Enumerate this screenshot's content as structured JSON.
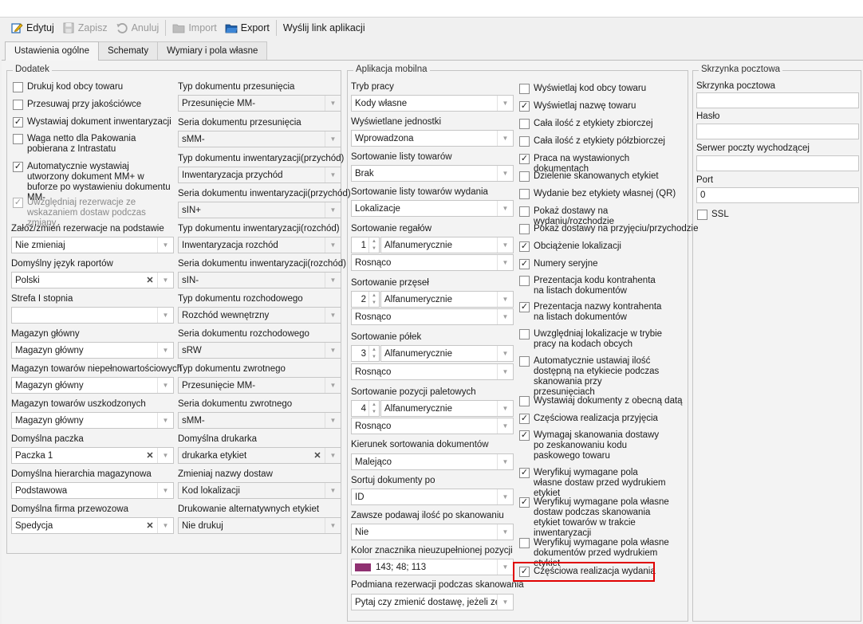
{
  "toolbar": {
    "edit": "Edytuj",
    "save": "Zapisz",
    "cancel": "Anuluj",
    "import": "Import",
    "export": "Export",
    "send_link": "Wyślij link aplikacji"
  },
  "tabs": [
    "Ustawienia ogólne",
    "Schematy",
    "Wymiary i pola własne"
  ],
  "colors": {
    "marker": "#8F3071",
    "highlight": "#E00000"
  },
  "dodatek": {
    "title": "Dodatek",
    "checkboxes": [
      {
        "label": "Drukuj kod obcy towaru",
        "checked": false
      },
      {
        "label": "Przesuwaj przy jakościówce",
        "checked": false
      },
      {
        "label": "Wystawiaj dokument inwentaryzacji",
        "checked": true
      },
      {
        "label": "Waga netto dla Pakowania pobierana z Intrastatu",
        "checked": false
      },
      {
        "label": "Automatycznie wystawiaj utworzony dokument MM+ w buforze po wystawieniu dokumentu MM-",
        "checked": true
      },
      {
        "label": "Uwzględniaj rezerwacje ze wskazaniem dostaw podczas zmiany",
        "checked": true
      }
    ],
    "left_fields": [
      {
        "label": "Załóż/zmień rezerwacje na podstawie",
        "value": "Nie zmieniaj"
      },
      {
        "label": "Domyślny język raportów",
        "value": "Polski"
      },
      {
        "label": "Strefa I stopnia",
        "value": ""
      },
      {
        "label": "Magazyn główny",
        "value": "Magazyn główny"
      },
      {
        "label": "Magazyn towarów niepełnowartościowych",
        "value": "Magazyn główny"
      },
      {
        "label": "Magazyn towarów uszkodzonych",
        "value": "Magazyn główny"
      },
      {
        "label": "Domyślna paczka",
        "value": "Paczka 1"
      },
      {
        "label": "Domyślna hierarchia magazynowa",
        "value": "Podstawowa"
      },
      {
        "label": "Domyślna firma przewozowa",
        "value": "Spedycja"
      }
    ],
    "right_fields": [
      {
        "label": "Typ dokumentu przesunięcia",
        "value": "Przesunięcie MM-"
      },
      {
        "label": "Seria dokumentu przesunięcia",
        "value": "sMM-"
      },
      {
        "label": "Typ dokumentu inwentaryzacji(przychód)",
        "value": "Inwentaryzacja przychód"
      },
      {
        "label": "Seria dokumentu inwentaryzacji(przychód)",
        "value": "sIN+"
      },
      {
        "label": "Typ dokumentu inwentaryzacji(rozchód)",
        "value": "Inwentaryzacja rozchód"
      },
      {
        "label": "Seria dokumentu inwentaryzacji(rozchód)",
        "value": "sIN-"
      },
      {
        "label": "Typ dokumentu rozchodowego",
        "value": "Rozchód wewnętrzny"
      },
      {
        "label": "Seria dokumentu rozchodowego",
        "value": "sRW"
      },
      {
        "label": "Typ dokumentu zwrotnego",
        "value": "Przesunięcie MM-"
      },
      {
        "label": "Seria dokumentu zwrotnego",
        "value": "sMM-"
      },
      {
        "label": "Domyślna drukarka",
        "value": "drukarka etykiet"
      },
      {
        "label": "Zmieniaj nazwy dostaw",
        "value": "Kod lokalizacji"
      },
      {
        "label": "Drukowanie alternatywnych etykiet",
        "value": "Nie drukuj"
      }
    ]
  },
  "mobile": {
    "title": "Aplikacja mobilna",
    "fields": [
      {
        "label": "Tryb pracy",
        "value": "Kody własne"
      },
      {
        "label": "Wyświetlane jednostki",
        "value": "Wprowadzona"
      },
      {
        "label": "Sortowanie listy towarów",
        "value": "Brak"
      },
      {
        "label": "Sortowanie listy towarów wydania",
        "value": "Lokalizacje"
      },
      {
        "label": "Sortowanie regałów",
        "num": "1",
        "value": "Alfanumerycznie",
        "order": "Rosnąco"
      },
      {
        "label": "Sortowanie przęseł",
        "num": "2",
        "value": "Alfanumerycznie",
        "order": "Rosnąco"
      },
      {
        "label": "Sortowanie półek",
        "num": "3",
        "value": "Alfanumerycznie",
        "order": "Rosnąco"
      },
      {
        "label": "Sortowanie pozycji paletowych",
        "num": "4",
        "value": "Alfanumerycznie",
        "order": "Rosnąco"
      },
      {
        "label": "Kierunek sortowania dokumentów",
        "value": "Malejąco"
      },
      {
        "label": "Sortuj dokumenty po",
        "value": "ID"
      },
      {
        "label": "Zawsze podawaj ilość po skanowaniu",
        "value": "Nie"
      },
      {
        "label": "Kolor znacznika nieuzupełnionej pozycji",
        "value": "143; 48; 113"
      },
      {
        "label": "Podmiana rezerwacji podczas skanowania",
        "value": "Pytaj czy zmienić dostawę, jeżeli ze..."
      }
    ],
    "checkboxes": [
      {
        "label": "Wyświetlaj kod obcy towaru",
        "checked": false
      },
      {
        "label": "Wyświetlaj nazwę towaru",
        "checked": true
      },
      {
        "label": "Cała ilość z etykiety zbiorczej",
        "checked": false
      },
      {
        "label": "Cała ilość z etykiety półzbiorczej",
        "checked": false
      },
      {
        "label": "Praca na wystawionych dokumentach",
        "checked": true
      },
      {
        "label": "Dzielenie skanowanych etykiet",
        "checked": false
      },
      {
        "label": "Wydanie bez etykiety własnej (QR)",
        "checked": false
      },
      {
        "label": "Pokaż dostawy na wydaniu/rozchodzie",
        "checked": false
      },
      {
        "label": "Pokaż dostawy na przyjęciu/przychodzie",
        "checked": false
      },
      {
        "label": "Obciążenie lokalizacji",
        "checked": true
      },
      {
        "label": "Numery seryjne",
        "checked": true
      },
      {
        "label": "Prezentacja kodu kontrahenta na listach dokumentów",
        "checked": false
      },
      {
        "label": "Prezentacja nazwy kontrahenta na listach dokumentów",
        "checked": true
      },
      {
        "label": "Uwzględniaj lokalizacje w trybie pracy na kodach obcych",
        "checked": false
      },
      {
        "label": "Automatycznie ustawiaj ilość dostępną na etykiecie podczas skanowania przy przesunięciach",
        "checked": false
      },
      {
        "label": "Wystawiaj dokumenty z obecną datą",
        "checked": false
      },
      {
        "label": "Częściowa realizacja przyjęcia",
        "checked": true
      },
      {
        "label": "Wymagaj skanowania dostawy po zeskanowaniu kodu paskowego towaru",
        "checked": true
      },
      {
        "label": "Weryfikuj wymagane pola własne dostaw przed wydrukiem etykiet",
        "checked": true
      },
      {
        "label": "Weryfikuj wymagane pola własne dostaw podczas skanowania etykiet towarów w trakcie inwentaryzacji",
        "checked": true
      },
      {
        "label": "Weryfikuj wymagane pola własne dokumentów przed wydrukiem etykiet",
        "checked": false
      },
      {
        "label": "Częściowa realizacja wydania",
        "checked": true
      }
    ]
  },
  "mailbox": {
    "title": "Skrzynka pocztowa",
    "fields": [
      {
        "label": "Skrzynka pocztowa",
        "value": ""
      },
      {
        "label": "Hasło",
        "value": ""
      },
      {
        "label": "Serwer poczty wychodzącej",
        "value": ""
      },
      {
        "label": "Port",
        "value": "0"
      }
    ],
    "ssl": {
      "label": "SSL",
      "checked": false
    }
  }
}
